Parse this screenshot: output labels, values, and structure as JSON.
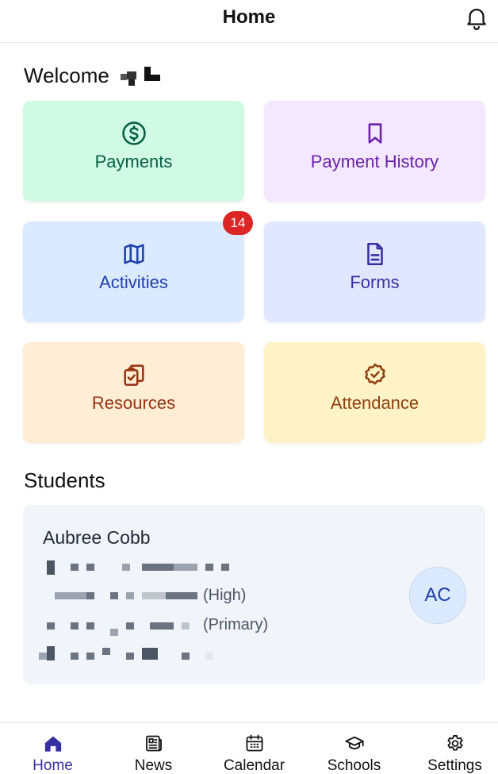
{
  "header": {
    "title": "Home",
    "bell_icon": "bell-icon"
  },
  "welcome": {
    "label": "Welcome"
  },
  "tiles": [
    {
      "label": "Payments",
      "icon": "dollar-circle-icon",
      "bg": "#d1fae5",
      "fg": "#065f46"
    },
    {
      "label": "Payment History",
      "icon": "bookmark-icon",
      "bg": "#f3e8ff",
      "fg": "#6b21a8"
    },
    {
      "label": "Activities",
      "icon": "map-icon",
      "bg": "#dbeafe",
      "fg": "#1e40af",
      "badge": "14"
    },
    {
      "label": "Forms",
      "icon": "document-icon",
      "bg": "#e0e7ff",
      "fg": "#3730a3"
    },
    {
      "label": "Resources",
      "icon": "clipboard-copy-icon",
      "bg": "#ffedd5",
      "fg": "#9a3412"
    },
    {
      "label": "Attendance",
      "icon": "check-badge-icon",
      "bg": "#fef3c7",
      "fg": "#92400e"
    }
  ],
  "students": {
    "heading": "Students",
    "items": [
      {
        "name": "Aubree Cobb",
        "level_high": "(High)",
        "level_primary": "(Primary)",
        "initials": "AC"
      }
    ]
  },
  "tabbar": {
    "items": [
      {
        "label": "Home",
        "icon": "home-icon",
        "active": true
      },
      {
        "label": "News",
        "icon": "newspaper-icon",
        "active": false
      },
      {
        "label": "Calendar",
        "icon": "calendar-icon",
        "active": false
      },
      {
        "label": "Schools",
        "icon": "graduation-cap-icon",
        "active": false
      },
      {
        "label": "Settings",
        "icon": "gear-icon",
        "active": false
      }
    ]
  },
  "colors": {
    "accent": "#3730a3",
    "badge": "#dc2626"
  }
}
